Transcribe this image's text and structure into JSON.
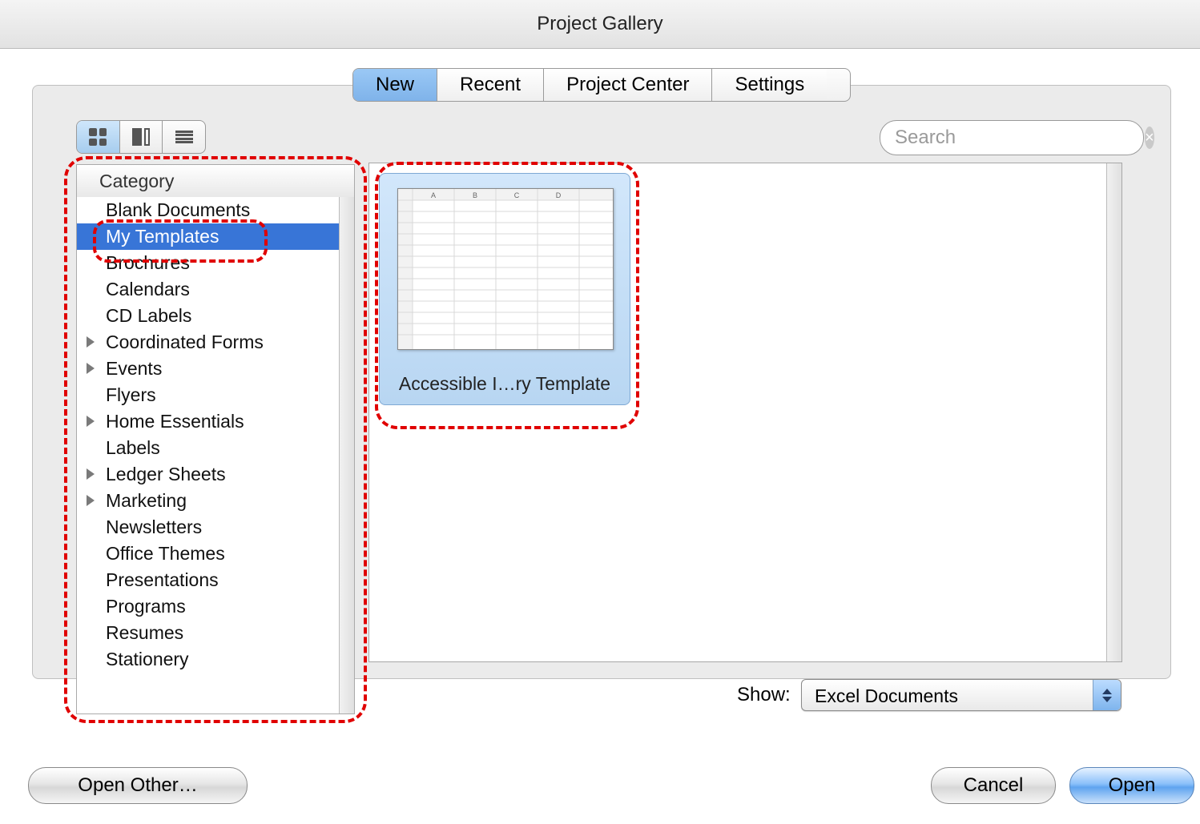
{
  "window": {
    "title": "Project Gallery"
  },
  "tabs": {
    "new": "New",
    "recent": "Recent",
    "project_center": "Project Center",
    "settings": "Settings"
  },
  "search": {
    "placeholder": "Search"
  },
  "sidebar": {
    "header": "Category",
    "items": [
      {
        "label": "Blank Documents",
        "expandable": false
      },
      {
        "label": "My Templates",
        "expandable": false,
        "selected": true
      },
      {
        "label": "Brochures",
        "expandable": false
      },
      {
        "label": "Calendars",
        "expandable": false
      },
      {
        "label": "CD Labels",
        "expandable": false
      },
      {
        "label": "Coordinated Forms",
        "expandable": true
      },
      {
        "label": "Events",
        "expandable": true
      },
      {
        "label": "Flyers",
        "expandable": false
      },
      {
        "label": "Home Essentials",
        "expandable": true
      },
      {
        "label": "Labels",
        "expandable": false
      },
      {
        "label": "Ledger Sheets",
        "expandable": true
      },
      {
        "label": "Marketing",
        "expandable": true
      },
      {
        "label": "Newsletters",
        "expandable": false
      },
      {
        "label": "Office Themes",
        "expandable": false
      },
      {
        "label": "Presentations",
        "expandable": false
      },
      {
        "label": "Programs",
        "expandable": false
      },
      {
        "label": "Resumes",
        "expandable": false
      },
      {
        "label": "Stationery",
        "expandable": false
      }
    ]
  },
  "templates": {
    "items": [
      {
        "label": "Accessible I…ry Template"
      }
    ]
  },
  "show": {
    "label": "Show:",
    "value": "Excel Documents"
  },
  "buttons": {
    "open_other": "Open Other…",
    "cancel": "Cancel",
    "open": "Open"
  }
}
